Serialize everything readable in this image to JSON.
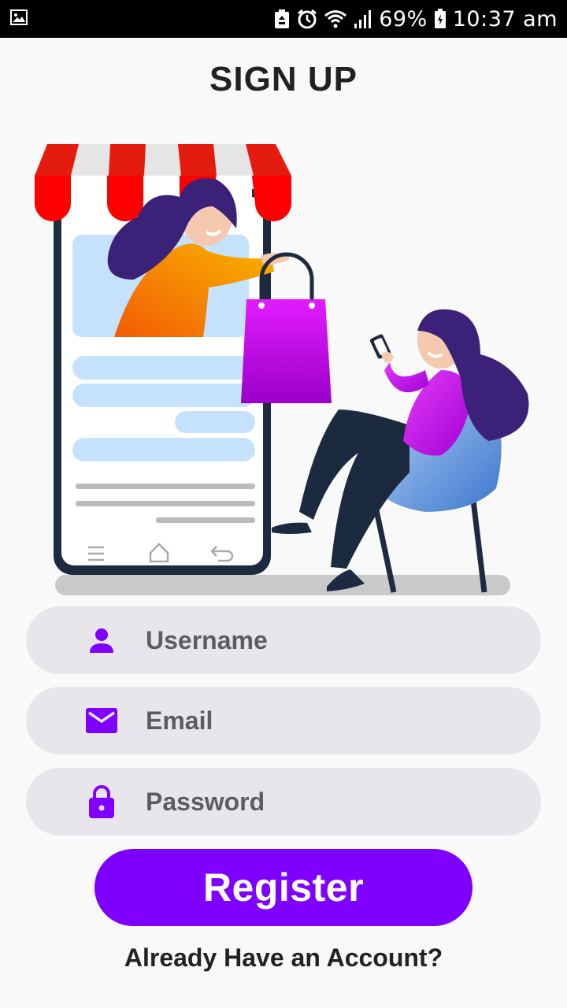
{
  "status_bar": {
    "icons": [
      "image-icon",
      "recycle-icon",
      "alarm-icon",
      "wifi-icon",
      "signal-icon",
      "battery-icon"
    ],
    "battery": "69%",
    "time": "10:37 am"
  },
  "title": "SIGN UP",
  "form": {
    "username": {
      "placeholder": "Username",
      "icon": "person-icon"
    },
    "email": {
      "placeholder": "Email",
      "icon": "mail-icon"
    },
    "password": {
      "placeholder": "Password",
      "icon": "lock-icon"
    }
  },
  "register_label": "Register",
  "login_prompt": "Already Have an Account?",
  "colors": {
    "accent": "#7f00ff",
    "field_bg": "#e8e6eb",
    "background": "#f9f9f9"
  }
}
